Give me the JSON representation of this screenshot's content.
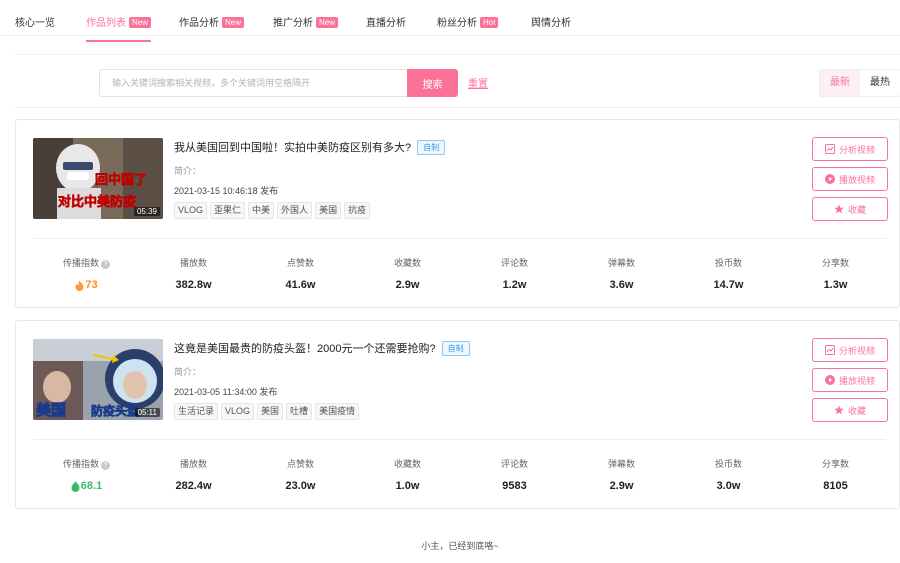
{
  "tabs": [
    {
      "label": "核心一览",
      "badge": ""
    },
    {
      "label": "作品列表",
      "badge": "New"
    },
    {
      "label": "作品分析",
      "badge": "New"
    },
    {
      "label": "推广分析",
      "badge": "New"
    },
    {
      "label": "直播分析",
      "badge": ""
    },
    {
      "label": "粉丝分析",
      "badge": "Hot"
    },
    {
      "label": "舆情分析",
      "badge": ""
    }
  ],
  "search": {
    "placeholder": "输入关键词搜索相关视频，多个关键词用空格隔开",
    "button": "搜索",
    "reset": "重置"
  },
  "sort": {
    "latest": "最新",
    "hottest": "最热"
  },
  "action_labels": {
    "analyze": "分析视频",
    "play": "播放视频",
    "favorite": "收藏"
  },
  "stat_labels": [
    "传播指数",
    "播放数",
    "点赞数",
    "收藏数",
    "评论数",
    "弹幕数",
    "投币数",
    "分享数"
  ],
  "colors": {
    "accent": "#fb7299",
    "score_orange": "#ff8a1f",
    "score_green": "#3fb86b"
  },
  "videos": [
    {
      "title": "我从美国回到中国啦！实拍中美防疫区别有多大?",
      "badge": "自制",
      "intro": "简介：",
      "published": "2021-03-15 10:46:18 发布",
      "duration": "05:39",
      "thumb_text_1": "回中国了",
      "thumb_text_2": "对比中美防疫",
      "tags": [
        "VLOG",
        "歪果仁",
        "中美",
        "外国人",
        "美国",
        "抗疫"
      ],
      "score_icon": "fire-icon",
      "score": "73",
      "plays": "382.8w",
      "likes": "41.6w",
      "favorites": "2.9w",
      "comments": "1.2w",
      "danmaku": "3.6w",
      "coins": "14.7w",
      "shares": "1.3w"
    },
    {
      "title": "这竟是美国最贵的防疫头盔！2000元一个还需要抢购?",
      "badge": "自制",
      "intro": "简介：",
      "published": "2021-03-05 11:34:00 发布",
      "duration": "05:11",
      "thumb_text_1": "美国",
      "thumb_text_2": "防疫头盔",
      "tags": [
        "生活记录",
        "VLOG",
        "美国",
        "吐槽",
        "美国疫情"
      ],
      "score_icon": "leaf-icon",
      "score": "68.1",
      "plays": "282.4w",
      "likes": "23.0w",
      "favorites": "1.0w",
      "comments": "9583",
      "danmaku": "2.9w",
      "coins": "3.0w",
      "shares": "8105"
    }
  ],
  "footer": "小主，已经到底咯~"
}
